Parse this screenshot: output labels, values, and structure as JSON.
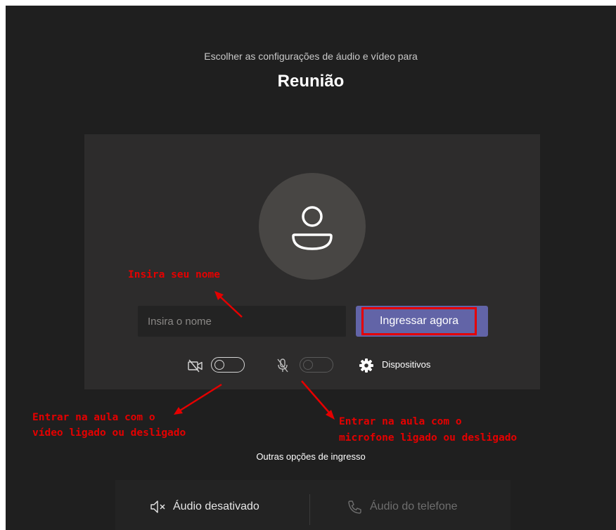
{
  "header": {
    "subtitle": "Escolher as configurações de áudio e vídeo para",
    "title": "Reunião"
  },
  "prejoin": {
    "name_placeholder": "Insira o nome",
    "join_label": "Ingressar agora",
    "video_toggle_on": false,
    "mic_toggle_on": false,
    "mic_toggle_disabled": true,
    "devices_label": "Dispositivos",
    "icons": {
      "avatar": "person-icon",
      "video": "video-off-icon",
      "mic": "mic-off-icon",
      "devices": "gear-icon"
    }
  },
  "annotations": {
    "name": "Insira seu nome",
    "video_line1": "Entrar na aula com o",
    "video_line2": "vídeo ligado ou desligado",
    "mic_line1": "Entrar na aula com o",
    "mic_line2": "microfone ligado ou desligado"
  },
  "other_options": {
    "title": "Outras opções de ingresso",
    "audio_off_label": "Áudio desativado",
    "phone_audio_label": "Áudio do telefone"
  },
  "colors": {
    "background": "#1f1f1f",
    "card": "#2d2c2c",
    "accent": "#6264a7",
    "annotation": "#e50000"
  }
}
